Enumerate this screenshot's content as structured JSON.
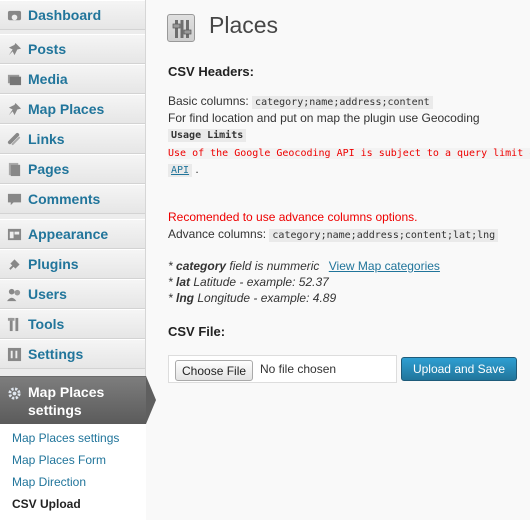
{
  "sidebar": {
    "items": [
      {
        "label": "Dashboard",
        "icon": "dashboard-icon"
      },
      {
        "label": "Posts",
        "icon": "pin-icon"
      },
      {
        "label": "Media",
        "icon": "media-icon"
      },
      {
        "label": "Map Places",
        "icon": "pin-icon"
      },
      {
        "label": "Links",
        "icon": "link-icon"
      },
      {
        "label": "Pages",
        "icon": "pages-icon"
      },
      {
        "label": "Comments",
        "icon": "comments-icon"
      },
      {
        "label": "Appearance",
        "icon": "appearance-icon"
      },
      {
        "label": "Plugins",
        "icon": "plugins-icon"
      },
      {
        "label": "Users",
        "icon": "users-icon"
      },
      {
        "label": "Tools",
        "icon": "tools-icon"
      },
      {
        "label": "Settings",
        "icon": "settings-icon"
      }
    ],
    "active": {
      "label": "Map Places settings",
      "icon": "gear-icon"
    },
    "submenu": [
      "Map Places settings",
      "Map Places Form",
      "Map Direction",
      "CSV Upload"
    ]
  },
  "main": {
    "title": "Places",
    "csv_headers_heading": "CSV Headers:",
    "basic_label": "Basic columns:",
    "basic_columns": "category;name;address;content",
    "find_location_text": "For find location and put on map the plugin use Geocoding",
    "usage_limits": "Usage Limits",
    "geocoding_notice": "Use of the Google Geocoding API is subject to a query limit of",
    "api_link": "API",
    "api_suffix": ".",
    "recommend_text": "Recomended to use advance columns options.",
    "advance_label": "Advance columns:",
    "advance_columns": "category;name;address;content;lat;lng",
    "note_category_key": "category",
    "note_category_text": "field is nummeric",
    "view_categories_link": "View Map categories",
    "note_lat_key": "lat",
    "note_lat_text": "Latitude - example: 52.37",
    "note_lng_key": "lng",
    "note_lng_text": "Longitude - example: 4.89",
    "csv_file_heading": "CSV File:",
    "choose_file_label": "Choose File",
    "no_file_text": "No file chosen",
    "upload_button_label": "Upload and Save"
  },
  "colors": {
    "link": "#21759b",
    "alert": "#e00000",
    "active_menu": "#6a6a6a",
    "primary_button": "#21759b"
  }
}
